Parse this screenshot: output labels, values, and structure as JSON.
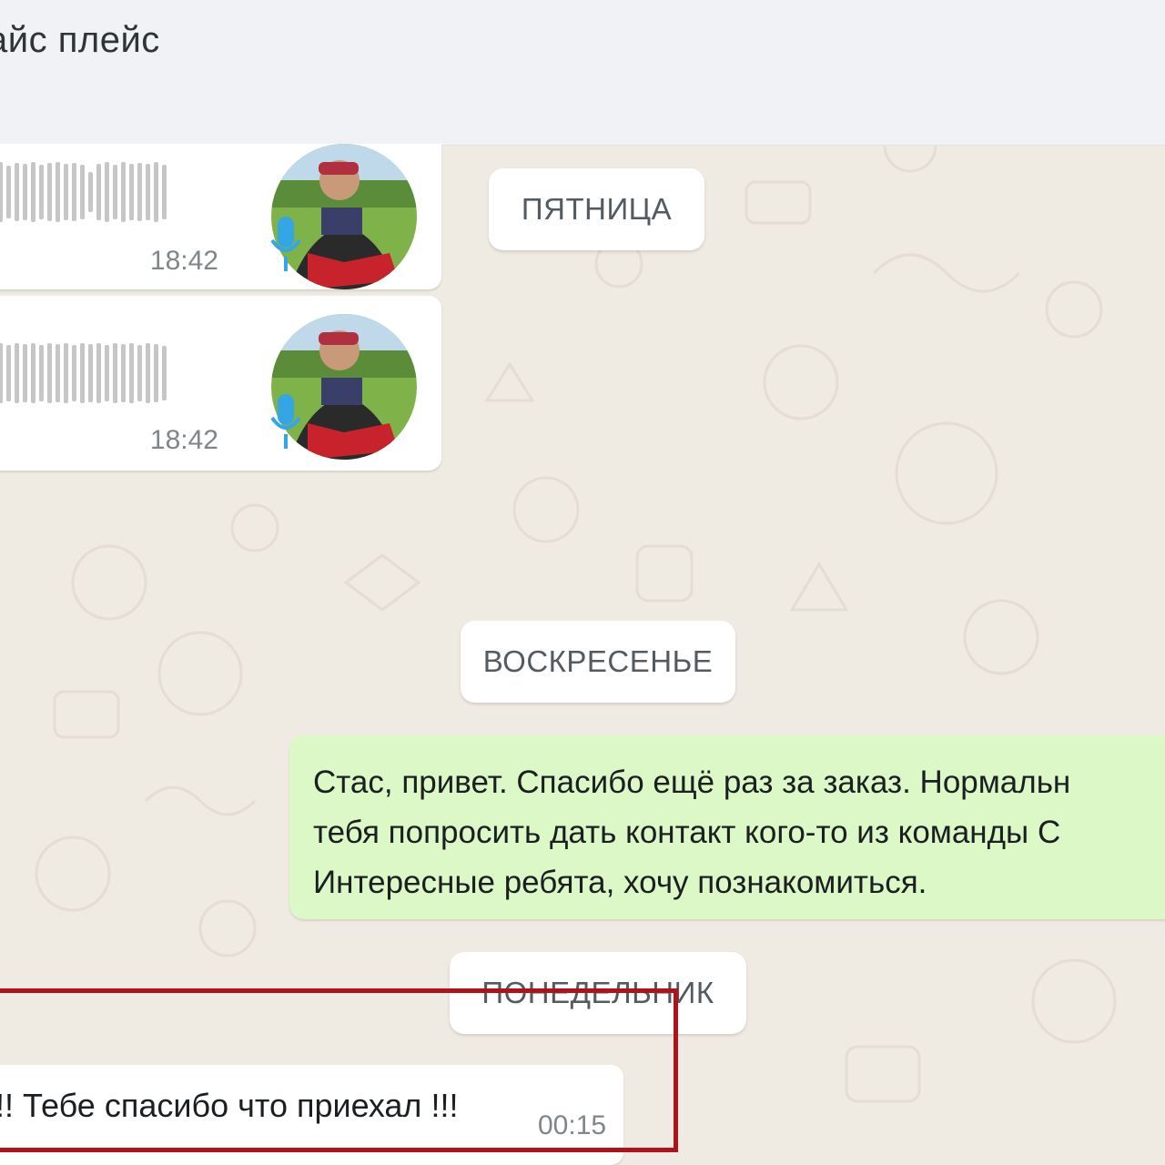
{
  "header": {
    "title": "айс плейс"
  },
  "messages": {
    "voice_1": {
      "time": "18:42"
    },
    "voice_2": {
      "time": "18:42"
    },
    "outgoing": {
      "lines": [
        "Стас, привет. Спасибо ещё раз за заказ. Нормальн",
        "тебя попросить дать контакт кого-то из команды С",
        "Интересные ребята, хочу познакомиться."
      ]
    },
    "incoming_last": {
      "text": "!! Тебе спасибо что приехал !!!",
      "time": "00:15"
    }
  },
  "day_separators": {
    "friday": "ПЯТНИЦА",
    "sunday": "ВОСКРЕСЕНЬЕ",
    "monday": "ПОНЕДЕЛЬНИК"
  },
  "colors": {
    "chat_background": "#efeae2",
    "incoming_bubble": "#ffffff",
    "outgoing_bubble": "#dcf8c6",
    "mic_accent": "#34a6e6",
    "highlight": "#b0121a"
  },
  "icons": {
    "mic": "mic-icon",
    "avatar": "contact-avatar"
  }
}
